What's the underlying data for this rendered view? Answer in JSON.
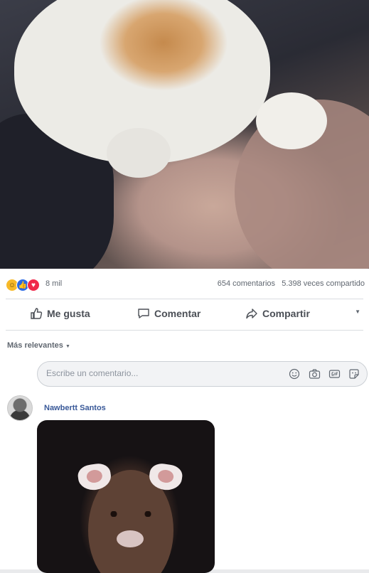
{
  "post": {
    "reactions": {
      "types": [
        "haha",
        "like",
        "love"
      ],
      "count_label": "8 mil"
    },
    "stats": {
      "comments_label": "654 comentarios",
      "shares_label": "5.398 veces compartido"
    },
    "actions": {
      "like_label": "Me gusta",
      "comment_label": "Comentar",
      "share_label": "Compartir"
    }
  },
  "comments": {
    "sort_label": "Más relevantes",
    "composer": {
      "placeholder": "Escribe un comentario..."
    },
    "items": [
      {
        "author": "Nawbertt Santos"
      }
    ]
  },
  "colors": {
    "accent": "#385898",
    "haha": "#f7b928",
    "like": "#2d6be4",
    "love": "#f0284a"
  }
}
